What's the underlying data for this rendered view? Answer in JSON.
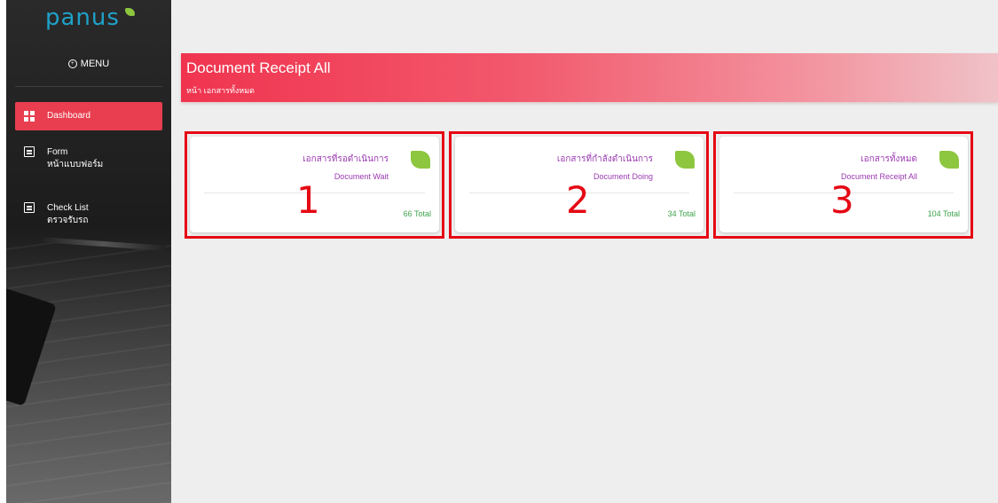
{
  "sidebar": {
    "logo": "panus",
    "menu_label": "MENU",
    "items": [
      {
        "label": "Dashboard",
        "sub": "",
        "icon": "dashboard-icon",
        "active": true
      },
      {
        "label": "Form",
        "sub": "หน้าแบบฟอร์ม",
        "icon": "form-icon",
        "active": false
      },
      {
        "label": "Check List",
        "sub": "ตรวจรับรถ",
        "icon": "checklist-icon",
        "active": false
      }
    ]
  },
  "header": {
    "title": "Document Receipt All",
    "subtitle": "หน้า เอกสารทั้งหมด"
  },
  "cards": [
    {
      "title": "เอกสารที่รอดำเนินการ",
      "subtitle": "Document Wait",
      "total": "66 Total",
      "number": "1"
    },
    {
      "title": "เอกสารที่กำลังดำเนินการ",
      "subtitle": "Document Doing",
      "total": "34 Total",
      "number": "2"
    },
    {
      "title": "เอกสารทั้งหมด",
      "subtitle": "Document Receipt All",
      "total": "104 Total",
      "number": "3"
    }
  ],
  "colors": {
    "accent_red": "#e83e4f",
    "brand_blue": "#1fa1c9",
    "leaf_green": "#8dc63f",
    "card_text_purple": "#9b3ab1",
    "total_green": "#3ea34a",
    "annotation_red": "#e50914"
  }
}
